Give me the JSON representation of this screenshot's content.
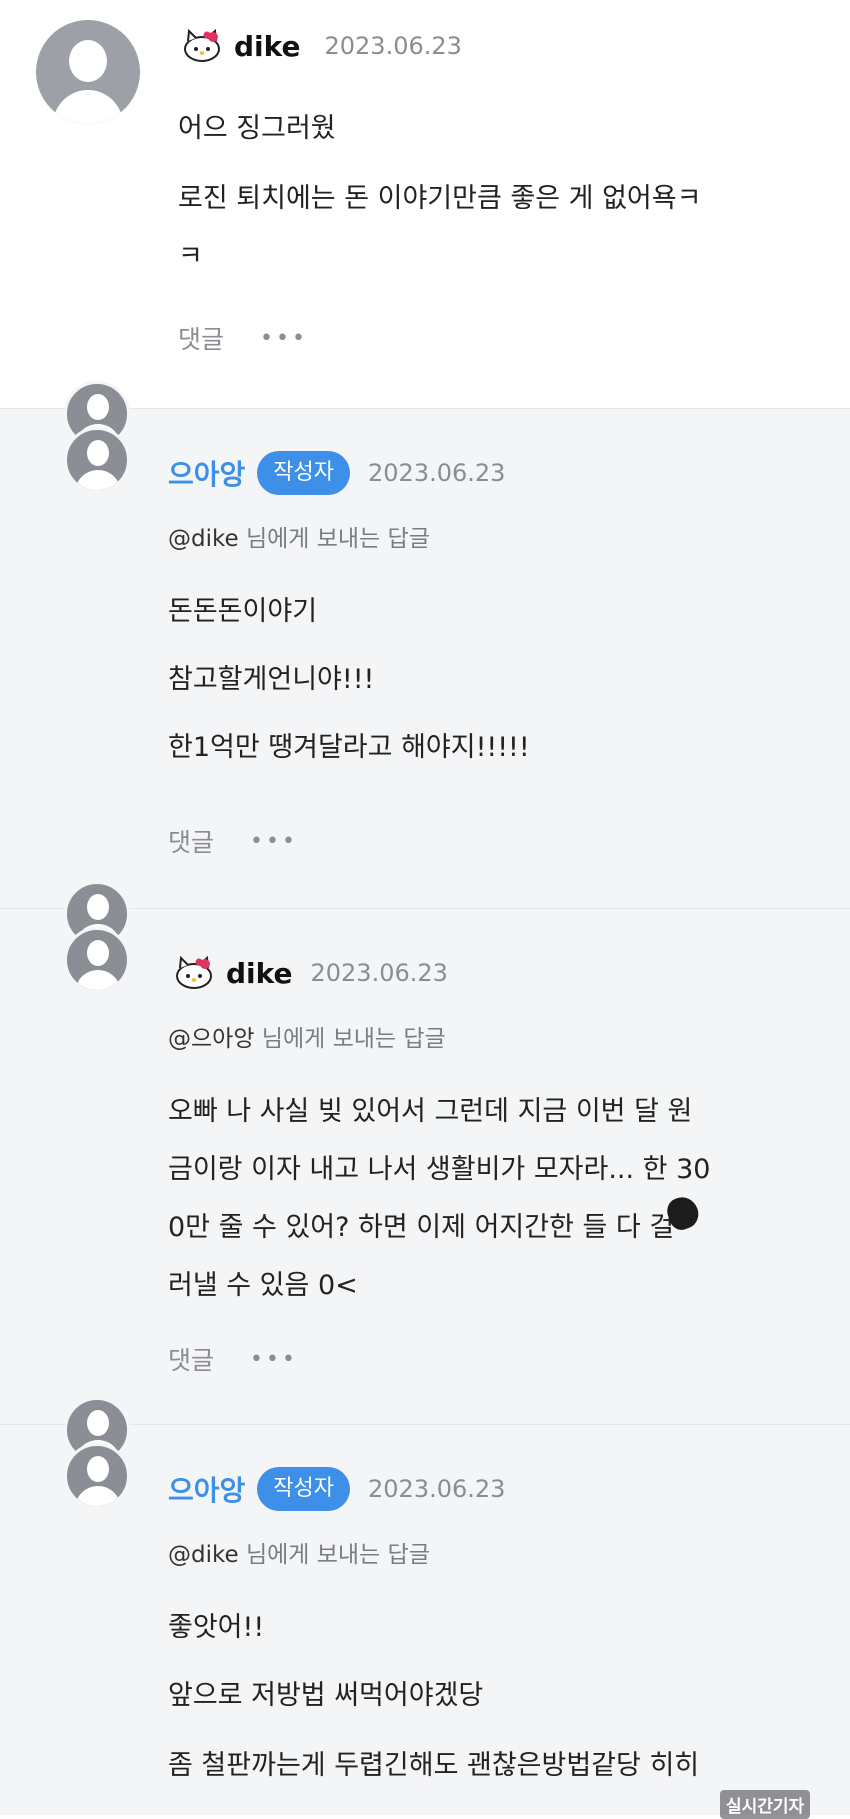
{
  "comments": [
    {
      "name": "dike",
      "date": "2023.06.23",
      "lines": [
        "어으 징그러웠",
        "로진 퇴치에는 돈 이야기만큼 좋은 게 없어욕ㅋ",
        "ㅋ"
      ],
      "reply_label": "댓글",
      "more": "•••"
    },
    {
      "name": "으아앙",
      "badge": "작성자",
      "date": "2023.06.23",
      "mention_user": "@dike",
      "mention_suffix": " 님에게 보내는 답글",
      "lines": [
        "돈돈돈이야기",
        "참고할게언니야!!!",
        "한1억만 땡겨달라고 해야지!!!!!"
      ],
      "reply_label": "댓글",
      "more": "•••"
    },
    {
      "name": "dike",
      "date": "2023.06.23",
      "mention_user": "@으아앙",
      "mention_suffix": " 님에게 보내는 답글",
      "lines": [
        "오빠 나 사실 빚 있어서 그런데 지금 이번 달 원",
        "금이랑 이자 내고 나서 생활비가 모자라... 한 30",
        "0만 줄 수 있어? 하면 이제 어지간한  들 다 걸",
        "러낼 수 있음 0<"
      ],
      "reply_label": "댓글",
      "more": "•••"
    },
    {
      "name": "으아앙",
      "badge": "작성자",
      "date": "2023.06.23",
      "mention_user": "@dike",
      "mention_suffix": " 님에게 보내는 답글",
      "lines": [
        "좋앗어!!",
        "앞으로 저방법 써먹어야겠당",
        "좀 철판까는게 두렵긴해도 괜찮은방법같당 히히"
      ]
    }
  ],
  "watermark": "실시간기자",
  "colors": {
    "author_accent": "#3d8fe8",
    "reply_bg": "#f4f5f7",
    "muted": "#8a8d92"
  },
  "icons": [
    "hello-kitty-icon",
    "default-avatar-icon",
    "more-dots-icon"
  ]
}
